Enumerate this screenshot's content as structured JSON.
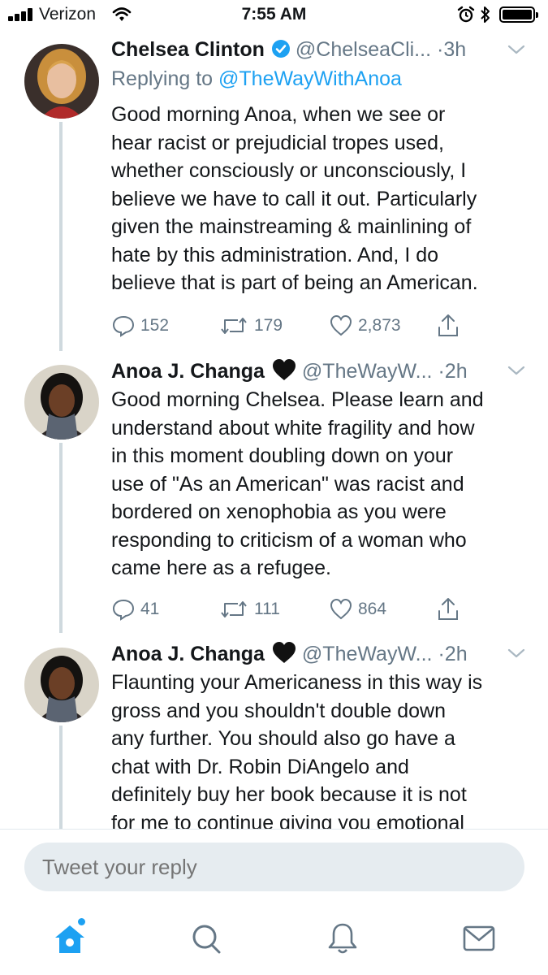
{
  "status_bar": {
    "carrier": "Verizon",
    "time": "7:55 AM"
  },
  "tweets": [
    {
      "name": "Chelsea Clinton",
      "handle": "@ChelseaCli...",
      "dot": "·",
      "age": "3h",
      "verified": true,
      "replying_prefix": "Replying to",
      "replying_to": "@TheWayWithAnoa",
      "lines": [
        "Good morning Anoa, when we see or",
        "hear racist or prejudicial tropes used,",
        "whether consciously or unconsciously, I",
        "believe we have to call it out. Particularly",
        "given the mainstreaming & mainlining of",
        "hate by this administration. And, I do",
        "believe that is part of being an American."
      ],
      "replies": "152",
      "retweets": "179",
      "likes": "2,873"
    },
    {
      "name": "Anoa J. Changa",
      "handle": "@TheWayW...",
      "dot": "·",
      "age": "2h",
      "emoji": "black-heart",
      "lines": [
        "Good morning Chelsea. Please learn and",
        "understand about white fragility and how",
        "in this moment doubling down on your",
        "use of \"As an American\" was racist and",
        "bordered on xenophobia as you were",
        "responding to criticism of a woman who",
        "came here as a refugee."
      ],
      "replies": "41",
      "retweets": "111",
      "likes": "864"
    },
    {
      "name": "Anoa J. Changa",
      "handle": "@TheWayW...",
      "dot": "·",
      "age": "2h",
      "emoji": "black-heart",
      "lines": [
        "Flaunting your Americaness in this way is",
        "gross and you shouldn't double down",
        "any further. You should also go have a",
        "chat with Dr. Robin DiAngelo and",
        "definitely buy her book because it is not",
        "for me to continue giving you emotional"
      ]
    }
  ],
  "reply_bar": {
    "placeholder": "Tweet your reply"
  },
  "tab_bar": {
    "items": [
      "home-icon",
      "search-icon",
      "bell-icon",
      "mail-icon"
    ]
  },
  "colors": {
    "accent": "#1da1f2",
    "secondary_text": "#657786",
    "thread_line": "#cfd9de",
    "input_bg": "#e6ecf0"
  }
}
